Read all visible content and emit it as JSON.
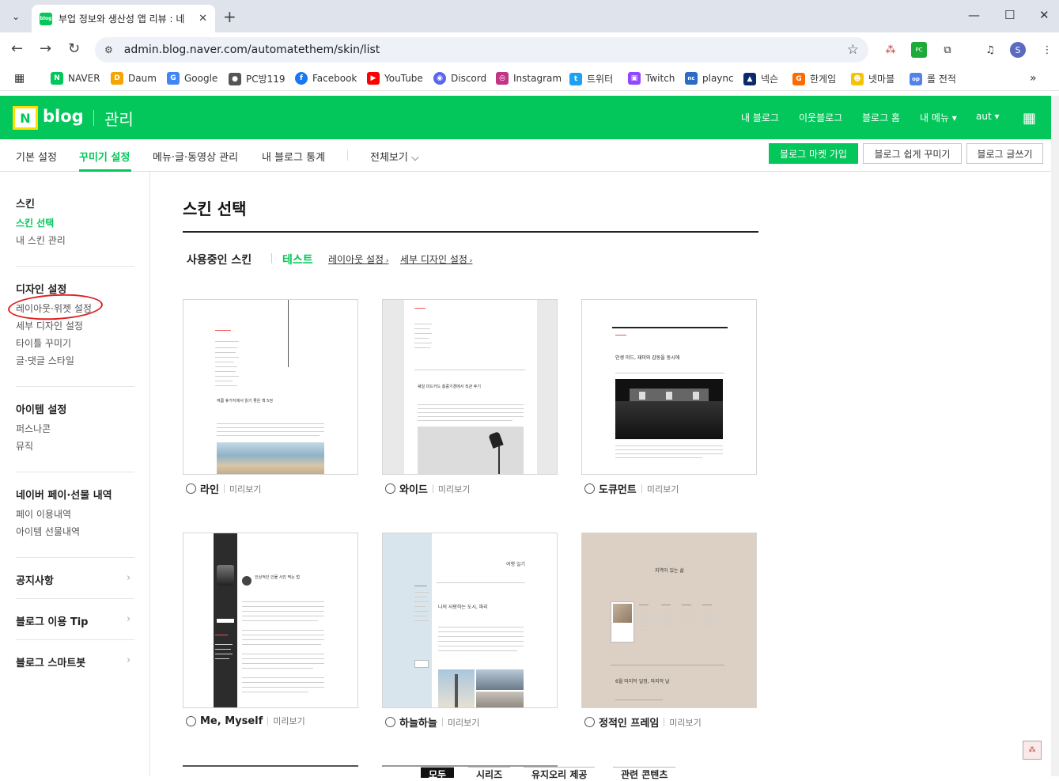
{
  "browser": {
    "tab_title": "부업 정보와 생산성 앱 리뷰 : 네",
    "tab_favicon": "blog",
    "url": "admin.blog.naver.com/automatethem/skin/list",
    "profile_initial": "S"
  },
  "bookmarks": [
    {
      "label": "NAVER",
      "icon": "N",
      "color": "#03c75a"
    },
    {
      "label": "Daum",
      "icon": "D",
      "color": "#f6a500"
    },
    {
      "label": "Google",
      "icon": "G",
      "color": "#4285f4"
    },
    {
      "label": "PC방119",
      "icon": "●",
      "color": "#555555"
    },
    {
      "label": "Facebook",
      "icon": "f",
      "color": "#1877f2"
    },
    {
      "label": "YouTube",
      "icon": "▶",
      "color": "#ff0000"
    },
    {
      "label": "Discord",
      "icon": "◉",
      "color": "#5865f2"
    },
    {
      "label": "Instagram",
      "icon": "◎",
      "color": "#c13584"
    },
    {
      "label": "트위터",
      "icon": "t",
      "color": "#1da1f2"
    },
    {
      "label": "Twitch",
      "icon": "▣",
      "color": "#9146ff"
    },
    {
      "label": "plaync",
      "icon": "nc",
      "color": "#2b6cc4"
    },
    {
      "label": "넥슨",
      "icon": "▲",
      "color": "#0b2a6b"
    },
    {
      "label": "한게임",
      "icon": "G",
      "color": "#ff6a00"
    },
    {
      "label": "넷마블",
      "icon": "☻",
      "color": "#f5c400"
    },
    {
      "label": "롤 전적",
      "icon": "op",
      "color": "#5383e8"
    }
  ],
  "header": {
    "logo_n": "N",
    "logo_blog": "blog",
    "logo_admin": "관리",
    "menu": [
      "내 블로그",
      "이웃블로그",
      "블로그 홈",
      "내 메뉴 ▾",
      "aut ▾"
    ]
  },
  "subnav": {
    "items": [
      "기본 설정",
      "꾸미기 설정",
      "메뉴·글·동영상 관리",
      "내 블로그 통계",
      "전체보기 ⌵"
    ],
    "buttons": [
      "블로그 마켓 가입",
      "블로그 쉽게 꾸미기",
      "블로그 글쓰기"
    ]
  },
  "sidebar": {
    "skin_head": "스킨",
    "skin_items": [
      "스킨 선택",
      "내 스킨 관리"
    ],
    "design_head": "디자인 설정",
    "design_items": [
      "레이아웃·위젯 설정",
      "세부 디자인 설정",
      "타이틀 꾸미기",
      "글·댓글 스타일"
    ],
    "item_head": "아이템 설정",
    "item_items": [
      "퍼스나콘",
      "뮤직"
    ],
    "pay_head": "네이버 페이·선물 내역",
    "pay_items": [
      "페이 이용내역",
      "아이템 선물내역"
    ],
    "links": [
      "공지사항",
      "블로그 이용 Tip",
      "블로그 스마트봇"
    ]
  },
  "main": {
    "title": "스킨 선택",
    "using_label": "사용중인 스킨",
    "using_name": "테스트",
    "layout_link": "레이아웃 설정",
    "detail_link": "세부 디자인 설정",
    "preview_label": "미리보기",
    "skins": [
      {
        "name": "라인",
        "headline": "여름 휴가지에서 읽기 좋은 책 5권"
      },
      {
        "name": "와이드",
        "headline": "쉐일 미드카드 홍콩기경에서 직관 후기"
      },
      {
        "name": "도큐먼트",
        "headline": "인생 미드, 재미와 감동을 동시에"
      },
      {
        "name": "Me, Myself",
        "headline": "인상적인 인물 사진 찍는 법"
      },
      {
        "name": "하늘하늘",
        "headline": "나의 사랑하는 도시, 파리",
        "side_title": "여행 일기"
      },
      {
        "name": "정적인 프레임",
        "headline": "6월 마지막 일정, 마지막 날",
        "side_title": "지역이 있는 삶"
      }
    ]
  },
  "bottom_tabs": [
    "모두",
    "시리즈",
    "유지오리 제공",
    "관련 콘텐츠"
  ]
}
